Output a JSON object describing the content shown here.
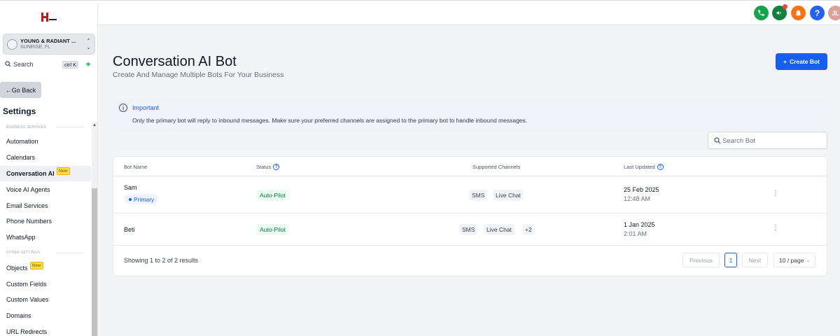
{
  "topbar": {
    "icons": [
      "phone-icon",
      "megaphone-icon",
      "bell-icon",
      "help-icon"
    ],
    "avatar_initials": "JL",
    "help_label": "?"
  },
  "sidebar": {
    "account": {
      "name": "YOUNG & RADIANT ...",
      "location": "SUNRISE, FL"
    },
    "search": {
      "label": "Search",
      "shortcut": "ctrl K"
    },
    "go_back": "Go Back",
    "title": "Settings",
    "section_business": "BUSINESS SERVICES",
    "section_other": "OTHER SETTINGS",
    "items": [
      {
        "label": "Automation"
      },
      {
        "label": "Calendars"
      },
      {
        "label": "Conversation AI",
        "badge": "New"
      },
      {
        "label": "Voice AI Agents"
      },
      {
        "label": "Email Services"
      },
      {
        "label": "Phone Numbers"
      },
      {
        "label": "WhatsApp"
      },
      {
        "label": "Objects",
        "badge": "New"
      },
      {
        "label": "Custom Fields"
      },
      {
        "label": "Custom Values"
      },
      {
        "label": "Domains"
      },
      {
        "label": "URL Redirects"
      }
    ]
  },
  "main": {
    "title": "Conversation AI Bot",
    "subtitle": "Create And Manage Multiple Bots For Your Business",
    "create_button": "Create Bot",
    "notice": {
      "title": "Important",
      "text": "Only the primary bot will reply to inbound messages. Make sure your preferred channels are assigned to the primary bot to handle inbound messages."
    },
    "search_placeholder": "Search Bot",
    "table": {
      "headers": {
        "name": "Bot Name",
        "status": "Status",
        "channels": "Supported Channels",
        "updated": "Last Updated"
      },
      "rows": [
        {
          "name": "Sam",
          "badge": "Primary",
          "status": "Auto-Pilot",
          "channels": [
            "SMS",
            "Live Chat"
          ],
          "date": "25 Feb 2025",
          "time": "12:48 AM"
        },
        {
          "name": "Beti",
          "status": "Auto-Pilot",
          "channels": [
            "SMS",
            "Live Chat",
            "+2"
          ],
          "date": "1 Jan 2025",
          "time": "2:01 AM"
        }
      ],
      "footer": "Showing 1 to 2 of 2 results",
      "pagination": {
        "previous": "Previous",
        "page": "1",
        "next": "Next",
        "page_size": "10 / page"
      }
    }
  },
  "colors": {
    "accent": "#155eef",
    "status_green": "#067647",
    "badge_new": "#fde047"
  }
}
